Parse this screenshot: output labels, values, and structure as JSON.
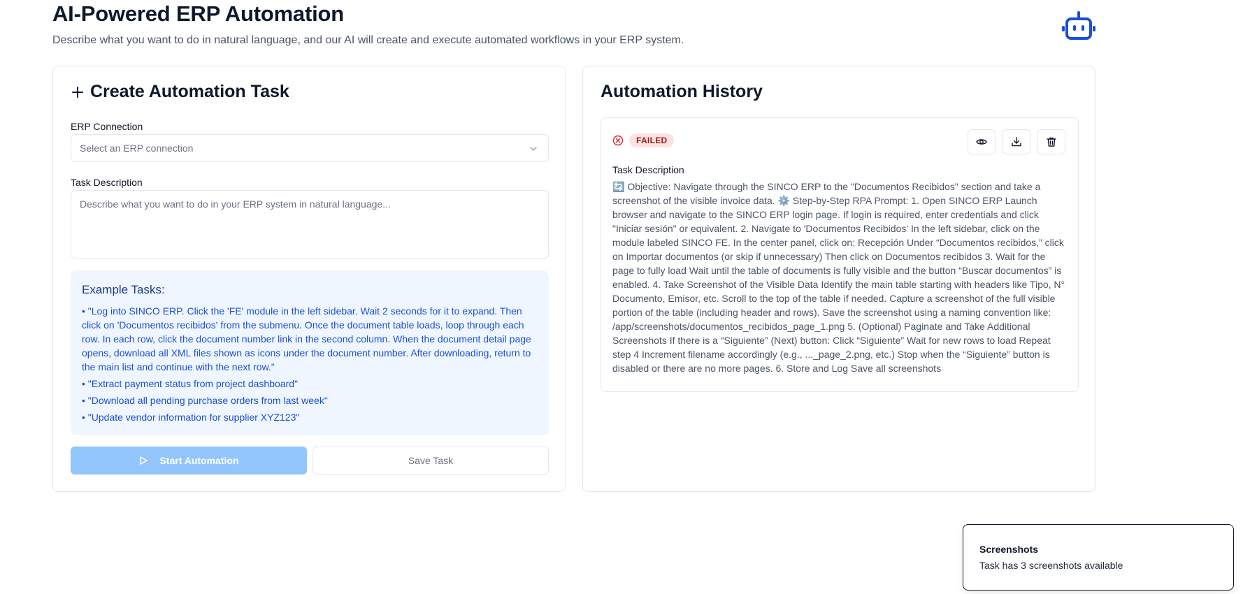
{
  "header": {
    "title": "AI-Powered ERP Automation",
    "subtitle": "Describe what you want to do in natural language, and our AI will create and execute automated workflows in your ERP system.",
    "icon": "bot-icon"
  },
  "colors": {
    "accent": "#1d4ed8",
    "primary_disabled": "#93c5fd",
    "examples_bg": "#eff6ff",
    "failed_bg": "#fee2e2",
    "failed_text": "#991b1b"
  },
  "create_task": {
    "title": "Create Automation Task",
    "icon": "plus-icon",
    "erp_label": "ERP Connection",
    "erp_placeholder": "Select an ERP connection",
    "task_label": "Task Description",
    "task_placeholder": "Describe what you want to do in your ERP system in natural language...",
    "examples_title": "Example Tasks:",
    "examples": [
      "• \"Log into SINCO ERP. Click the 'FE' module in the left sidebar. Wait 2 seconds for it to expand. Then click on 'Documentos recibidos' from the submenu. Once the document table loads, loop through each row. In each row, click the document number link in the second column. When the document detail page opens, download all XML files shown as icons under the document number. After downloading, return to the main list and continue with the next row.\"",
      "• \"Extract payment status from project dashboard\"",
      "• \"Download all pending purchase orders from last week\"",
      "• \"Update vendor information for supplier XYZ123\""
    ],
    "start_button": "Start Automation",
    "save_button": "Save Task"
  },
  "history": {
    "title": "Automation History",
    "item": {
      "status": "FAILED",
      "label": "Task Description",
      "description": "🔄 Objective: Navigate through the SINCO ERP to the \"Documentos Recibidos\" section and take a screenshot of the visible invoice data. ⚙️ Step-by-Step RPA Prompt: 1. Open SINCO ERP Launch browser and navigate to the SINCO ERP login page. If login is required, enter credentials and click \"Iniciar sesión\" or equivalent. 2. Navigate to 'Documentos Recibidos' In the left sidebar, click on the module labeled SINCO FE. In the center panel, click on: Recepción Under “Documentos recibidos,” click on Importar documentos (or skip if unnecessary) Then click on Documentos recibidos 3. Wait for the page to fully load Wait until the table of documents is fully visible and the button “Buscar documentos” is enabled. 4. Take Screenshot of the Visible Data Identify the main table starting with headers like Tipo, N° Documento, Emisor, etc. Scroll to the top of the table if needed. Capture a screenshot of the full visible portion of the table (including header and rows). Save the screenshot using a naming convention like: /app/screenshots/documentos_recibidos_page_1.png 5. (Optional) Paginate and Take Additional Screenshots If there is a “Siguiente” (Next) button: Click “Siguiente” Wait for new rows to load Repeat step 4 Increment filename accordingly (e.g., ..._page_2.png, etc.) Stop when the “Siguiente” button is disabled or there are no more pages. 6. Store and Log Save all screenshots"
    }
  },
  "toast": {
    "title": "Screenshots",
    "description": "Task has 3 screenshots available"
  }
}
